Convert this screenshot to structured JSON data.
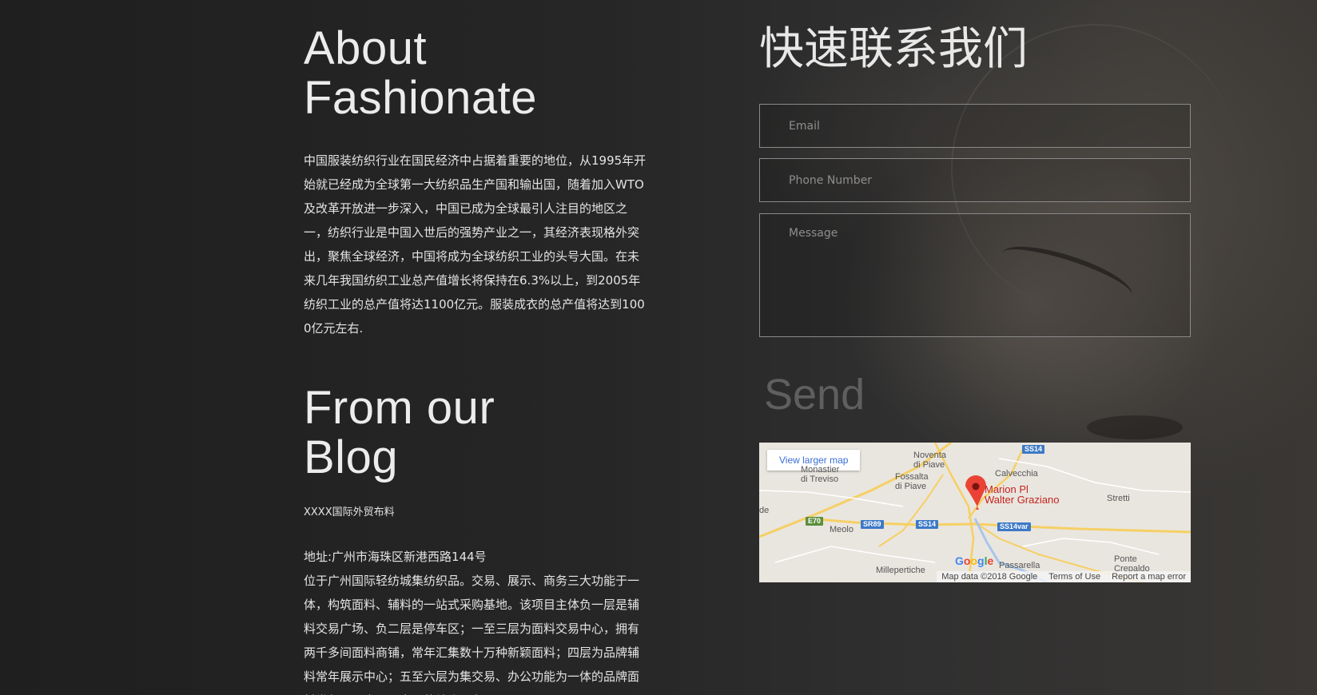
{
  "about": {
    "title_line1": "About",
    "title_line2": "Fashionate",
    "body": "中国服装纺织行业在国民经济中占据着重要的地位，从1995年开始就已经成为全球第一大纺织品生产国和输出国，随着加入WTO及改革开放进一步深入，中国已成为全球最引人注目的地区之一，纺织行业是中国入世后的强势产业之一，其经济表现格外突出，聚焦全球经济，中国将成为全球纺织工业的头号大国。在未来几年我国纺织工业总产值增长将保持在6.3%以上，到2005年纺织工业的总产值将达1100亿元。服装成衣的总产值将达到1000亿元左右."
  },
  "blog": {
    "title_line1": "From our",
    "title_line2": "Blog",
    "name": "XXXX国际外贸布料",
    "address": "地址:广州市海珠区新港西路144号",
    "body": "位于广州国际轻纺城集纺织品。交易、展示、商务三大功能于一体，构筑面料、辅料的一站式采购基地。该项目主体负一层是辅料交易广场、负二层是停车区；一至三层为面料交易中心，拥有两千多间面料商铺，常年汇集数十万种新颖面料；四层为品牌辅料常年展示中心；五至六层为集交易、办公功能为一体的品牌面料常年展示中心，占国的综合服务区"
  },
  "contact": {
    "title": "快速联系我们",
    "email_placeholder": "Email",
    "phone_placeholder": "Phone Number",
    "message_placeholder": "Message",
    "send_label": "Send"
  },
  "map": {
    "view_larger": "View larger map",
    "marker_label": "Marion Pl\nWalter Graziano",
    "places": {
      "noventa": "Noventa\ndi Piave",
      "monastier": "Monastier\ndi Treviso",
      "fossalta": "Fossalta\ndi Piave",
      "calvecchia": "Calvecchia",
      "stretti": "Stretti",
      "meolo": "Meolo",
      "de": "de",
      "millepertiche": "Millepertiche",
      "passarella": "Passarella",
      "ponte": "Ponte\nCrepaldo"
    },
    "highways": {
      "ss14_top": "SS14",
      "e70": "E70",
      "sr89": "SR89",
      "ss14_mid": "SS14",
      "ss14var": "SS14var"
    },
    "google": "Google",
    "map_data": "Map data ©2018 Google",
    "terms": "Terms of Use",
    "report": "Report a map error",
    "colors": {
      "road_major": "#f6cf65",
      "road_minor": "#ffffff",
      "water": "#a9c6ea",
      "marker": "#ea4335"
    }
  },
  "colors": {
    "background": "#252525",
    "text": "#e6e6e6",
    "send": "#5f5f5f",
    "field_border": "#8a8a8a"
  }
}
